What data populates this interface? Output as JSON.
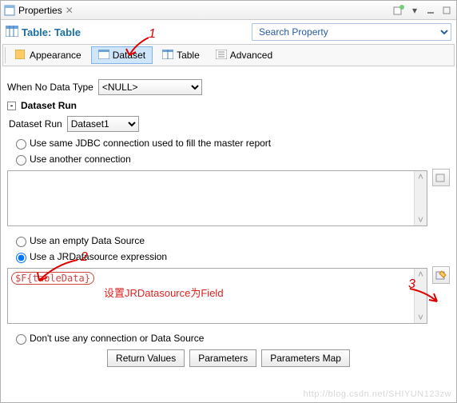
{
  "titlebar": {
    "title": "Properties"
  },
  "header": {
    "title_label": "Table: Table",
    "search_placeholder": "Search Property"
  },
  "tabs": {
    "appearance": "Appearance",
    "dataset": "Dataset",
    "table": "Table",
    "advanced": "Advanced"
  },
  "form": {
    "when_no_data_label": "When No Data Type",
    "when_no_data_value": "<NULL>",
    "section_title": "Dataset Run",
    "dataset_run_label": "Dataset Run",
    "dataset_run_value": "Dataset1",
    "opt_same_conn": "Use same JDBC connection used to fill the master report",
    "opt_another_conn": "Use another connection",
    "opt_empty_ds": "Use an empty Data Source",
    "opt_jr_ds": "Use a JRDatasource expression",
    "expr_value": "$F{tableData}",
    "opt_no_conn": "Don't use any connection or Data Source"
  },
  "annotations": {
    "n1": "1",
    "n2": "2",
    "n3": "3",
    "msg": "设置JRDatasource为Field"
  },
  "buttons": {
    "return_values": "Return Values",
    "parameters": "Parameters",
    "parameters_map": "Parameters Map"
  },
  "watermark": "http://blog.csdn.net/SHIYUN123zw"
}
